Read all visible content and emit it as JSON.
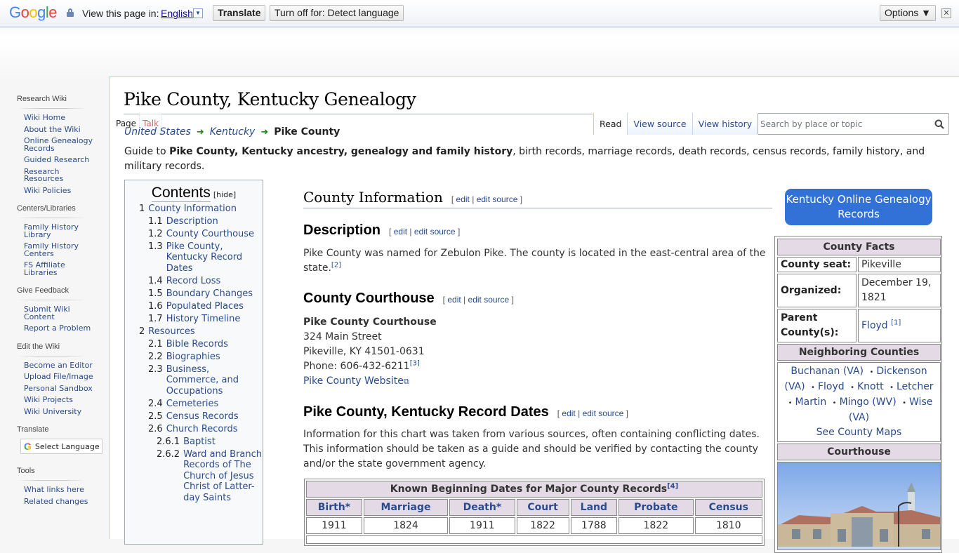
{
  "translate_bar": {
    "logo": "Google",
    "view_in_label": "View this page in:",
    "language": "English",
    "translate_button": "Translate",
    "turn_off_button": "Turn off for: Detect language",
    "options_button": "Options ▼",
    "close": "✕"
  },
  "sidebar": {
    "sections": [
      {
        "heading": "Research Wiki",
        "items": [
          "Wiki Home",
          "About the Wiki",
          "Online Genealogy Records",
          "Guided Research",
          "Research Resources",
          "Wiki Policies"
        ]
      },
      {
        "heading": "Centers/Libraries",
        "items": [
          "Family History Library",
          "Family History Centers",
          "FS Affiliate Libraries"
        ]
      },
      {
        "heading": "Give Feedback",
        "items": [
          "Submit Wiki Content",
          "Report a Problem"
        ]
      },
      {
        "heading": "Edit the Wiki",
        "items": [
          "Become an Editor",
          "Upload File/Image",
          "Personal Sandbox",
          "Wiki Projects",
          "Wiki University"
        ]
      },
      {
        "heading": "Translate",
        "select_language": "Select Language"
      },
      {
        "heading": "Tools",
        "items": [
          "What links here",
          "Related changes"
        ]
      }
    ]
  },
  "page": {
    "title": "Pike County, Kentucky Genealogy",
    "tabs_left": [
      "Page",
      "Talk"
    ],
    "tabs_right": [
      "Read",
      "View source",
      "View history"
    ],
    "search_placeholder": "Search by place or topic",
    "breadcrumb": {
      "first": "United States",
      "second": "Kentucky",
      "current": "Pike County",
      "arrow": "➜"
    },
    "intro": {
      "prefix": "Guide to ",
      "bold": "Pike County, Kentucky ancestry, genealogy and family history",
      "suffix": ", birth records, marriage records, death records, census records, family history, and military records."
    }
  },
  "toc": {
    "title": "Contents",
    "hide": "[hide]",
    "items": [
      {
        "num": "1",
        "text": "County Information",
        "level": 1
      },
      {
        "num": "1.1",
        "text": "Description",
        "level": 2
      },
      {
        "num": "1.2",
        "text": "County Courthouse",
        "level": 2
      },
      {
        "num": "1.3",
        "text": "Pike County, Kentucky Record Dates",
        "level": 2
      },
      {
        "num": "1.4",
        "text": "Record Loss",
        "level": 2
      },
      {
        "num": "1.5",
        "text": "Boundary Changes",
        "level": 2
      },
      {
        "num": "1.6",
        "text": "Populated Places",
        "level": 2
      },
      {
        "num": "1.7",
        "text": "History Timeline",
        "level": 2
      },
      {
        "num": "2",
        "text": "Resources",
        "level": 1
      },
      {
        "num": "2.1",
        "text": "Bible Records",
        "level": 2
      },
      {
        "num": "2.2",
        "text": "Biographies",
        "level": 2
      },
      {
        "num": "2.3",
        "text": "Business, Commerce, and Occupations",
        "level": 2
      },
      {
        "num": "2.4",
        "text": "Cemeteries",
        "level": 2
      },
      {
        "num": "2.5",
        "text": "Census Records",
        "level": 2
      },
      {
        "num": "2.6",
        "text": "Church Records",
        "level": 2
      },
      {
        "num": "2.6.1",
        "text": "Baptist",
        "level": 3
      },
      {
        "num": "2.6.2",
        "text": "Ward and Branch Records of The Church of Jesus Christ of Latter-day Saints",
        "level": 3
      }
    ]
  },
  "edit_links": {
    "open": "[",
    "edit": "edit",
    "sep": "|",
    "edit_source": "edit source",
    "close": "]"
  },
  "sections": {
    "county_info": {
      "heading": "County Information"
    },
    "description": {
      "heading": "Description",
      "text": "Pike County was named for Zebulon Pike. The county is located in the east-central area of the state.",
      "ref": "[2]"
    },
    "courthouse": {
      "heading": "County Courthouse",
      "name": "Pike County Courthouse",
      "street": "324 Main Street",
      "city": "Pikeville, KY 41501-0631",
      "phone": "Phone: 606-432-6211",
      "ref": "[3]",
      "website": "Pike County Website"
    },
    "record_dates": {
      "heading": "Pike County, Kentucky Record Dates",
      "text": "Information for this chart was taken from various sources, often containing conflicting dates. This information should be taken as a guide and should be verified by contacting the county and/or the state government agency.",
      "table": {
        "caption": "Known Beginning Dates for Major County Records",
        "ref": "[4]",
        "columns": [
          "Birth*",
          "Marriage",
          "Death*",
          "Court",
          "Land",
          "Probate",
          "Census"
        ],
        "values": [
          "1911",
          "1824",
          "1911",
          "1822",
          "1788",
          "1822",
          "1810"
        ]
      }
    }
  },
  "infobox": {
    "button": "Kentucky Online Genealogy Records",
    "facts_heading": "County Facts",
    "county_seat_label": "County seat:",
    "county_seat": "Pikeville",
    "organized_label": "Organized:",
    "organized": "December 19, 1821",
    "parent_label": "Parent County(s):",
    "parent": "Floyd",
    "parent_ref": "[1]",
    "neighbors_heading": "Neighboring Counties",
    "neighbors": [
      "Buchanan (VA)",
      "Dickenson (VA)",
      "Floyd",
      "Knott",
      "Letcher",
      "Martin",
      "Mingo (WV)",
      "Wise (VA)"
    ],
    "see_maps": "See County Maps",
    "courthouse_heading": "Courthouse"
  },
  "colors": {
    "link": "#2a4b8d",
    "accent_button": "#3271d6",
    "table_header_bg": "#e4dae6",
    "breadcrumb_arrow": "#1a8a1a"
  }
}
